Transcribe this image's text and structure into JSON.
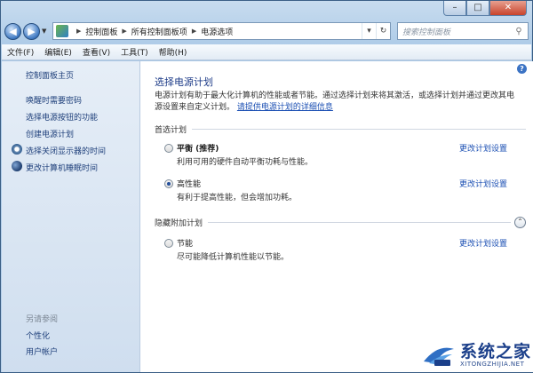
{
  "window": {
    "min_glyph": "–",
    "max_glyph": "□",
    "close_glyph": "✕"
  },
  "nav": {
    "back_glyph": "◀",
    "forward_glyph": "▶",
    "history_drop_glyph": "▼",
    "breadcrumb": [
      "控制面板",
      "所有控制面板项",
      "电源选项"
    ],
    "breadcrumb_sep": "▶",
    "addr_drop_glyph": "▾",
    "refresh_glyph": "↻",
    "search_placeholder": "搜索控制面板",
    "search_glyph": "⚲"
  },
  "menubar": {
    "items": [
      "文件(F)",
      "编辑(E)",
      "查看(V)",
      "工具(T)",
      "帮助(H)"
    ]
  },
  "sidebar": {
    "home": "控制面板主页",
    "links": [
      "唤醒时需要密码",
      "选择电源按钮的功能",
      "创建电源计划",
      "选择关闭显示器的时间",
      "更改计算机睡眠时间"
    ],
    "see_also_label": "另请参阅",
    "see_also": [
      "个性化",
      "用户帐户"
    ]
  },
  "main": {
    "help_glyph": "?",
    "title": "选择电源计划",
    "description_line1": "电源计划有助于最大化计算机的性能或者节能。通过选择计划来将其激活，或选择计划并通过更改其电",
    "description_line2_prefix": "源设置来自定义计划。",
    "description_link": "请提供电源计划的详细信息",
    "preferred_label": "首选计划",
    "hidden_label": "隐藏附加计划",
    "collapse_glyph": "⌃",
    "change_link": "更改计划设置",
    "plans": [
      {
        "name": "平衡 (推荐)",
        "desc": "利用可用的硬件自动平衡功耗与性能。",
        "selected": false
      },
      {
        "name": "高性能",
        "desc": "有利于提高性能，但会增加功耗。",
        "selected": true
      },
      {
        "name": "节能",
        "desc": "尽可能降低计算机性能以节能。",
        "selected": false
      }
    ]
  },
  "watermark": {
    "title": "系统之家",
    "url": "XITONGZHIJIA.NET"
  }
}
